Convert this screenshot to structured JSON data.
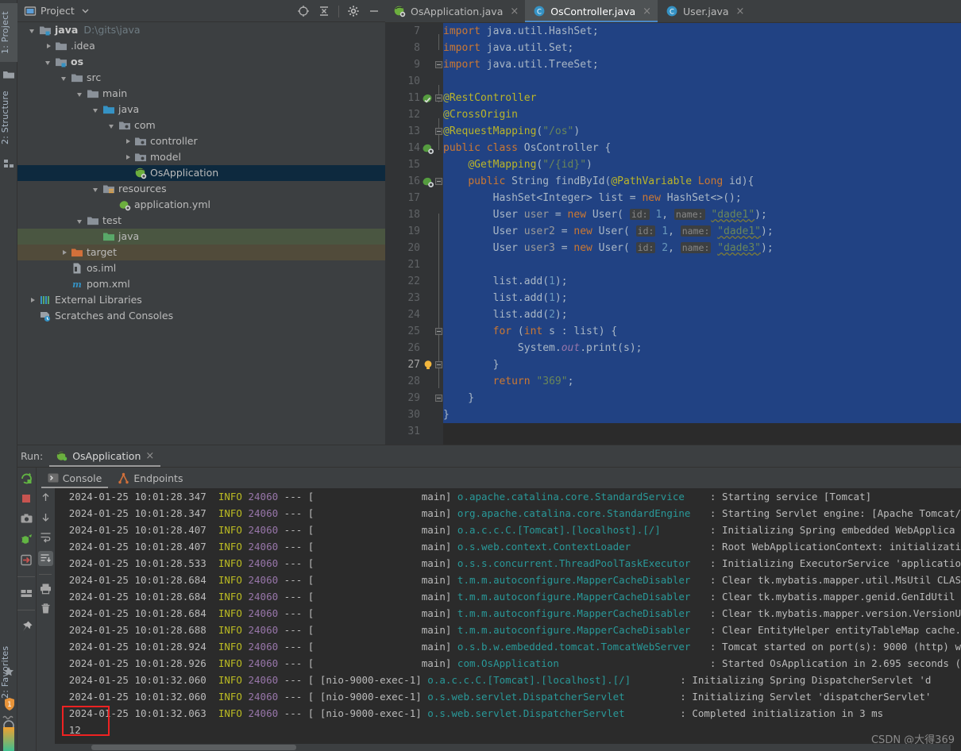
{
  "window": {
    "left_tool_tabs": [
      {
        "label": "1: Project",
        "selected": true
      },
      {
        "label": "2: Structure",
        "selected": false
      },
      {
        "label": "2: Favorites",
        "selected": false
      }
    ]
  },
  "project_panel": {
    "title": "Project",
    "header_icons": [
      "locate-icon",
      "collapse-all-icon",
      "gear-icon",
      "minimize-icon"
    ],
    "tree": [
      {
        "label": "java",
        "path": "D:\\gits\\java",
        "depth": 0,
        "arrow": "expanded",
        "icon": "module-folder-icon",
        "bold": true,
        "state": "none"
      },
      {
        "label": ".idea",
        "path": "",
        "depth": 1,
        "arrow": "collapsed",
        "icon": "folder-icon",
        "bold": false,
        "state": "none"
      },
      {
        "label": "os",
        "path": "",
        "depth": 1,
        "arrow": "expanded",
        "icon": "module-folder-icon",
        "bold": true,
        "state": "none"
      },
      {
        "label": "src",
        "path": "",
        "depth": 2,
        "arrow": "expanded",
        "icon": "folder-icon",
        "bold": false,
        "state": "none"
      },
      {
        "label": "main",
        "path": "",
        "depth": 3,
        "arrow": "expanded",
        "icon": "folder-icon",
        "bold": false,
        "state": "none"
      },
      {
        "label": "java",
        "path": "",
        "depth": 4,
        "arrow": "expanded",
        "icon": "source-folder-icon",
        "bold": false,
        "state": "none"
      },
      {
        "label": "com",
        "path": "",
        "depth": 5,
        "arrow": "expanded",
        "icon": "package-icon",
        "bold": false,
        "state": "none"
      },
      {
        "label": "controller",
        "path": "",
        "depth": 6,
        "arrow": "collapsed",
        "icon": "package-icon",
        "bold": false,
        "state": "none"
      },
      {
        "label": "model",
        "path": "",
        "depth": 6,
        "arrow": "collapsed",
        "icon": "package-icon",
        "bold": false,
        "state": "none"
      },
      {
        "label": "OsApplication",
        "path": "",
        "depth": 6,
        "arrow": "none",
        "icon": "spring-boot-class-icon",
        "bold": false,
        "state": "selected"
      },
      {
        "label": "resources",
        "path": "",
        "depth": 4,
        "arrow": "expanded",
        "icon": "resource-folder-icon",
        "bold": false,
        "state": "none"
      },
      {
        "label": "application.yml",
        "path": "",
        "depth": 5,
        "arrow": "none",
        "icon": "spring-yaml-icon",
        "bold": false,
        "state": "none"
      },
      {
        "label": "test",
        "path": "",
        "depth": 3,
        "arrow": "expanded",
        "icon": "folder-icon",
        "bold": false,
        "state": "none"
      },
      {
        "label": "java",
        "path": "",
        "depth": 4,
        "arrow": "none",
        "icon": "test-source-folder-icon",
        "bold": false,
        "state": "green"
      },
      {
        "label": "target",
        "path": "",
        "depth": 2,
        "arrow": "collapsed",
        "icon": "excluded-folder-icon",
        "bold": false,
        "state": "brown"
      },
      {
        "label": "os.iml",
        "path": "",
        "depth": 2,
        "arrow": "none",
        "icon": "iml-file-icon",
        "bold": false,
        "state": "none"
      },
      {
        "label": "pom.xml",
        "path": "",
        "depth": 2,
        "arrow": "none",
        "icon": "maven-icon",
        "bold": false,
        "state": "none"
      },
      {
        "label": "External Libraries",
        "path": "",
        "depth": 0,
        "arrow": "collapsed",
        "icon": "libraries-icon",
        "bold": false,
        "state": "none"
      },
      {
        "label": "Scratches and Consoles",
        "path": "",
        "depth": 0,
        "arrow": "none",
        "icon": "scratches-icon",
        "bold": false,
        "state": "none"
      }
    ]
  },
  "editor": {
    "tabs": [
      {
        "label": "OsApplication.java",
        "icon": "spring-boot-class-icon",
        "active": false
      },
      {
        "label": "OsController.java",
        "icon": "class-icon",
        "active": true
      },
      {
        "label": "User.java",
        "icon": "class-icon",
        "active": false
      }
    ],
    "close_glyph": "×",
    "lines": [
      {
        "num": "7",
        "gutter": "",
        "fold": "",
        "selected": true,
        "current": false
      },
      {
        "num": "8",
        "gutter": "",
        "fold": "",
        "selected": true,
        "current": false
      },
      {
        "num": "9",
        "gutter": "",
        "fold": "foldend",
        "selected": true,
        "current": false
      },
      {
        "num": "10",
        "gutter": "",
        "fold": "",
        "selected": true,
        "current": false
      },
      {
        "num": "11",
        "gutter": "spring-bean-icon",
        "fold": "foldstart",
        "selected": true,
        "current": false
      },
      {
        "num": "12",
        "gutter": "",
        "fold": "",
        "selected": true,
        "current": false
      },
      {
        "num": "13",
        "gutter": "",
        "fold": "foldend",
        "selected": true,
        "current": false
      },
      {
        "num": "14",
        "gutter": "spring-endpoint-icon",
        "fold": "",
        "selected": true,
        "current": false
      },
      {
        "num": "15",
        "gutter": "",
        "fold": "",
        "selected": true,
        "current": false
      },
      {
        "num": "16",
        "gutter": "spring-endpoint-icon",
        "fold": "foldstart",
        "selected": true,
        "current": false
      },
      {
        "num": "17",
        "gutter": "",
        "fold": "",
        "selected": true,
        "current": false
      },
      {
        "num": "18",
        "gutter": "",
        "fold": "",
        "selected": true,
        "current": false
      },
      {
        "num": "19",
        "gutter": "",
        "fold": "",
        "selected": true,
        "current": false
      },
      {
        "num": "20",
        "gutter": "",
        "fold": "",
        "selected": true,
        "current": false
      },
      {
        "num": "21",
        "gutter": "",
        "fold": "",
        "selected": true,
        "current": false
      },
      {
        "num": "22",
        "gutter": "",
        "fold": "",
        "selected": true,
        "current": false
      },
      {
        "num": "23",
        "gutter": "",
        "fold": "",
        "selected": true,
        "current": false
      },
      {
        "num": "24",
        "gutter": "",
        "fold": "",
        "selected": true,
        "current": false
      },
      {
        "num": "25",
        "gutter": "",
        "fold": "foldstart",
        "selected": true,
        "current": false
      },
      {
        "num": "26",
        "gutter": "",
        "fold": "",
        "selected": true,
        "current": false
      },
      {
        "num": "27",
        "gutter": "intention-bulb-icon",
        "fold": "foldend",
        "selected": true,
        "current": true
      },
      {
        "num": "28",
        "gutter": "",
        "fold": "",
        "selected": true,
        "current": false
      },
      {
        "num": "29",
        "gutter": "",
        "fold": "foldend",
        "selected": true,
        "current": false
      },
      {
        "num": "30",
        "gutter": "",
        "fold": "",
        "selected": true,
        "current": false
      },
      {
        "num": "31",
        "gutter": "",
        "fold": "",
        "selected": false,
        "current": false
      }
    ],
    "code_text": {
      "l7": "import java.util.HashSet;",
      "l8": "import java.util.Set;",
      "l9": "import java.util.TreeSet;",
      "l11": "@RestController",
      "l12": "@CrossOrigin",
      "l13": "@RequestMapping(\"/os\")",
      "l14": "public class OsController {",
      "l15": "@GetMapping(\"/{id}\")",
      "l16": "public String findById(@PathVariable Long id){",
      "l17": "HashSet<Integer> list = new HashSet<>();",
      "l18": "User user = new User( id: 1, name: \"dade1\");",
      "l19": "User user2 = new User( id: 1, name: \"dade1\");",
      "l20": "User user3 = new User( id: 2, name: \"dade3\");",
      "l22": "list.add(1);",
      "l23": "list.add(1);",
      "l24": "list.add(2);",
      "l25": "for (int s : list) {",
      "l26": "System.out.print(s);",
      "l27": "}",
      "l28": "return \"369\";",
      "l29": "}",
      "l30": "}"
    }
  },
  "run_panel": {
    "run_label": "Run:",
    "config_name": "OsApplication",
    "config_icon": "spring-boot-run-icon",
    "close_glyph": "×",
    "toolbar_icons": [
      "rerun-icon",
      "stop-icon",
      "camera-icon",
      "debug-icon",
      "exit-icon",
      "layout-icon",
      "pin-icon"
    ],
    "console_tabs": [
      {
        "label": "Console",
        "icon": "console-icon",
        "active": true
      },
      {
        "label": "Endpoints",
        "icon": "endpoints-icon",
        "active": false
      }
    ],
    "console_side_icons": [
      "scroll-up-icon",
      "scroll-down-icon",
      "soft-wrap-icon",
      "scroll-to-end-icon",
      "print-icon",
      "trash-icon"
    ],
    "log_lines": [
      {
        "date": "2024-01-25 10:01:28.347",
        "level": "INFO",
        "pid": "24060",
        "thread": "main]",
        "logger": "o.apache.catalina.core.StandardService",
        "msg": ": Starting service [Tomcat]"
      },
      {
        "date": "2024-01-25 10:01:28.347",
        "level": "INFO",
        "pid": "24060",
        "thread": "main]",
        "logger": "org.apache.catalina.core.StandardEngine",
        "msg": ": Starting Servlet engine: [Apache Tomcat/"
      },
      {
        "date": "2024-01-25 10:01:28.407",
        "level": "INFO",
        "pid": "24060",
        "thread": "main]",
        "logger": "o.a.c.c.C.[Tomcat].[localhost].[/]",
        "msg": ": Initializing Spring embedded WebApplica"
      },
      {
        "date": "2024-01-25 10:01:28.407",
        "level": "INFO",
        "pid": "24060",
        "thread": "main]",
        "logger": "o.s.web.context.ContextLoader",
        "msg": ": Root WebApplicationContext: initializati"
      },
      {
        "date": "2024-01-25 10:01:28.533",
        "level": "INFO",
        "pid": "24060",
        "thread": "main]",
        "logger": "o.s.s.concurrent.ThreadPoolTaskExecutor",
        "msg": ": Initializing ExecutorService 'applicatio"
      },
      {
        "date": "2024-01-25 10:01:28.684",
        "level": "INFO",
        "pid": "24060",
        "thread": "main]",
        "logger": "t.m.m.autoconfigure.MapperCacheDisabler",
        "msg": ": Clear tk.mybatis.mapper.util.MsUtil CLAS"
      },
      {
        "date": "2024-01-25 10:01:28.684",
        "level": "INFO",
        "pid": "24060",
        "thread": "main]",
        "logger": "t.m.m.autoconfigure.MapperCacheDisabler",
        "msg": ": Clear tk.mybatis.mapper.genid.GenIdUtil"
      },
      {
        "date": "2024-01-25 10:01:28.684",
        "level": "INFO",
        "pid": "24060",
        "thread": "main]",
        "logger": "t.m.m.autoconfigure.MapperCacheDisabler",
        "msg": ": Clear tk.mybatis.mapper.version.VersionU"
      },
      {
        "date": "2024-01-25 10:01:28.688",
        "level": "INFO",
        "pid": "24060",
        "thread": "main]",
        "logger": "t.m.m.autoconfigure.MapperCacheDisabler",
        "msg": ": Clear EntityHelper entityTableMap cache."
      },
      {
        "date": "2024-01-25 10:01:28.924",
        "level": "INFO",
        "pid": "24060",
        "thread": "main]",
        "logger": "o.s.b.w.embedded.tomcat.TomcatWebServer",
        "msg": ": Tomcat started on port(s): 9000 (http) w"
      },
      {
        "date": "2024-01-25 10:01:28.926",
        "level": "INFO",
        "pid": "24060",
        "thread": "main]",
        "logger": "com.OsApplication",
        "msg": ": Started OsApplication in 2.695 seconds ("
      },
      {
        "date": "2024-01-25 10:01:32.060",
        "level": "INFO",
        "pid": "24060",
        "thread": "[nio-9000-exec-1]",
        "logger": "o.a.c.c.C.[Tomcat].[localhost].[/]",
        "msg": ": Initializing Spring DispatcherServlet 'd"
      },
      {
        "date": "2024-01-25 10:01:32.060",
        "level": "INFO",
        "pid": "24060",
        "thread": "[nio-9000-exec-1]",
        "logger": "o.s.web.servlet.DispatcherServlet",
        "msg": ": Initializing Servlet 'dispatcherServlet'"
      },
      {
        "date": "2024-01-25 10:01:32.063",
        "level": "INFO",
        "pid": "24060",
        "thread": "[nio-9000-exec-1]",
        "logger": "o.s.web.servlet.DispatcherServlet",
        "msg": ": Completed initialization in 3 ms"
      }
    ],
    "program_output": "12",
    "highlight_color": "#ee2222"
  },
  "watermark": "CSDN @大得369",
  "colors": {
    "selection_blue": "#214283",
    "tree_selection": "#0d293e",
    "accent": "#4a88c7",
    "keyword": "#cc7832",
    "annotation": "#bbb529",
    "string": "#6a8759",
    "number": "#6897bb",
    "logger": "#299999",
    "level": "#bbbb23",
    "pid": "#9876aa"
  }
}
